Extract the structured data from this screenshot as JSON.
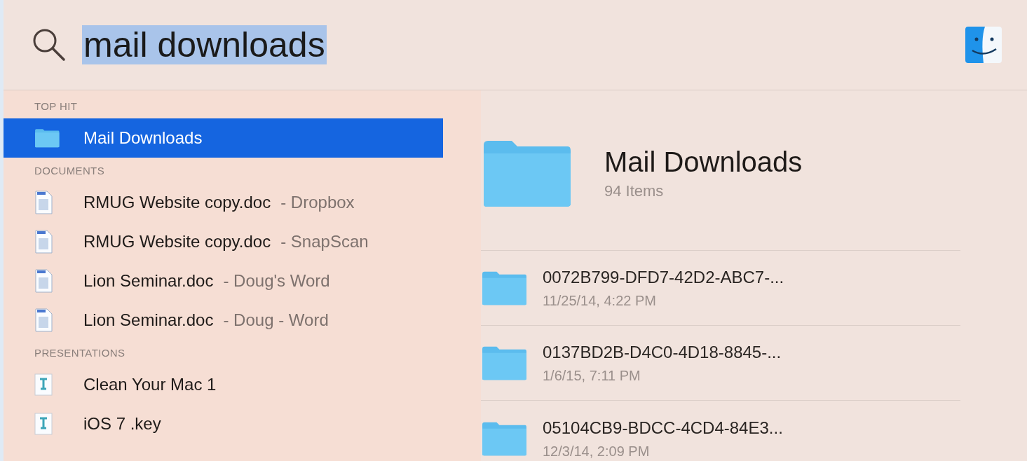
{
  "search": {
    "value": "mail downloads",
    "selected": true
  },
  "sections": [
    {
      "label": "TOP HIT",
      "items": [
        {
          "kind": "folder",
          "name": "Mail Downloads",
          "selected": true
        }
      ]
    },
    {
      "label": "DOCUMENTS",
      "items": [
        {
          "kind": "document",
          "name": "RMUG Website copy.doc",
          "location": "- Dropbox",
          "selected": false
        },
        {
          "kind": "document",
          "name": "RMUG Website copy.doc",
          "location": "- SnapScan",
          "selected": false
        },
        {
          "kind": "document",
          "name": "Lion Seminar.doc",
          "location": "- Doug's Word",
          "selected": false
        },
        {
          "kind": "document",
          "name": "Lion Seminar.doc",
          "location": "- Doug - Word",
          "selected": false
        }
      ]
    },
    {
      "label": "PRESENTATIONS",
      "items": [
        {
          "kind": "presentation",
          "name": "Clean Your Mac 1",
          "selected": false
        },
        {
          "kind": "presentation",
          "name": "iOS 7 .key",
          "selected": false
        }
      ]
    }
  ],
  "preview": {
    "title": "Mail Downloads",
    "subtitle": "94 Items",
    "items": [
      {
        "name": "0072B799-DFD7-42D2-ABC7-...",
        "date": "11/25/14, 4:22 PM"
      },
      {
        "name": "0137BD2B-D4C0-4D18-8845-...",
        "date": "1/6/15, 7:11 PM"
      },
      {
        "name": "05104CB9-BDCC-4CD4-84E3...",
        "date": "12/3/14, 2:09 PM"
      }
    ]
  }
}
